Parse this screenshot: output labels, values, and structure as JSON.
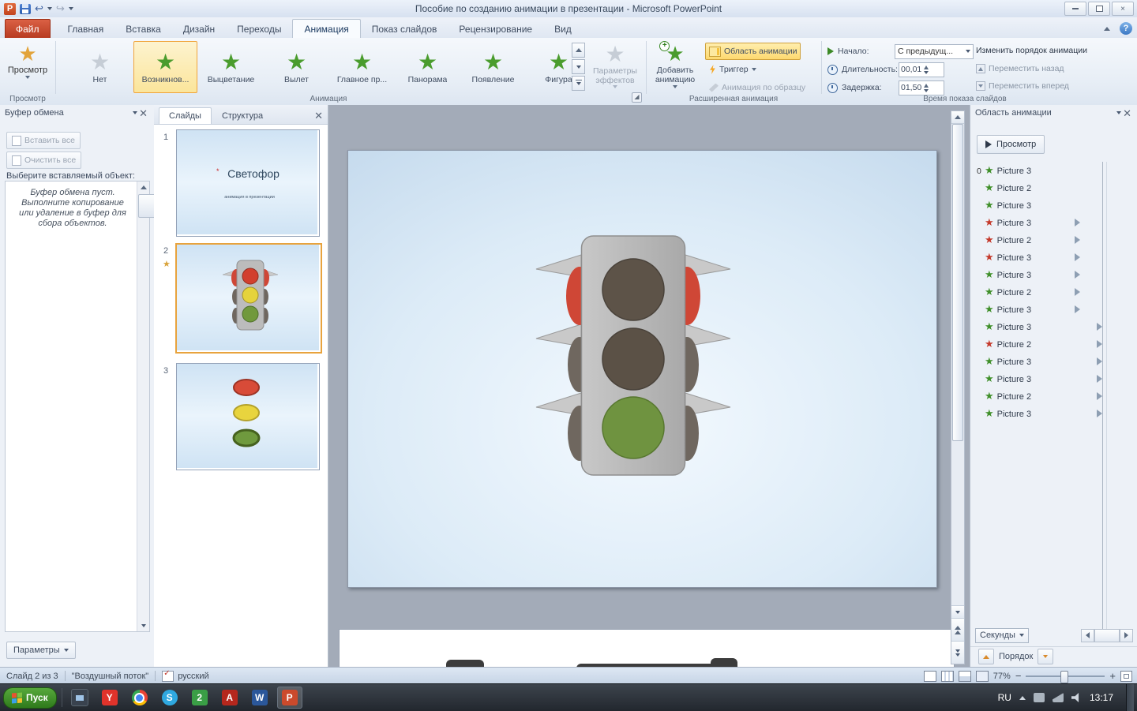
{
  "title_bar": {
    "title": "Пособие по созданию анимации в презентации  -  Microsoft PowerPoint"
  },
  "ribbon_tabs": [
    {
      "label": "Файл",
      "state": "file"
    },
    {
      "label": "Главная",
      "state": "normal"
    },
    {
      "label": "Вставка",
      "state": "normal"
    },
    {
      "label": "Дизайн",
      "state": "normal"
    },
    {
      "label": "Переходы",
      "state": "normal"
    },
    {
      "label": "Анимация",
      "state": "active"
    },
    {
      "label": "Показ слайдов",
      "state": "normal"
    },
    {
      "label": "Рецензирование",
      "state": "normal"
    },
    {
      "label": "Вид",
      "state": "normal"
    }
  ],
  "ribbon": {
    "preview_button": "Просмотр",
    "group_preview": "Просмотр",
    "gallery": [
      {
        "label": "Нет",
        "state": "none"
      },
      {
        "label": "Возникнов...",
        "state": "selected"
      },
      {
        "label": "Выцветание",
        "state": "normal"
      },
      {
        "label": "Вылет",
        "state": "normal"
      },
      {
        "label": "Главное пр...",
        "state": "normal"
      },
      {
        "label": "Панорама",
        "state": "normal"
      },
      {
        "label": "Появление",
        "state": "normal"
      },
      {
        "label": "Фигура",
        "state": "normal"
      }
    ],
    "group_animation": "Анимация",
    "effect_options": "Параметры эффектов",
    "add_animation": "Добавить анимацию",
    "animation_pane": "Область анимации",
    "trigger": "Триггер",
    "animation_painter": "Анимация по образцу",
    "group_advanced": "Расширенная анимация",
    "start_label": "Начало:",
    "start_value": "С предыдущ...",
    "duration_label": "Длительность:",
    "duration_value": "00,01",
    "delay_label": "Задержка:",
    "delay_value": "01,50",
    "reorder_title": "Изменить порядок анимации",
    "move_earlier": "Переместить назад",
    "move_later": "Переместить вперед",
    "group_timing": "Время показа слайдов"
  },
  "clipboard": {
    "title": "Буфер обмена",
    "paste_all": "Вставить все",
    "clear_all": "Очистить все",
    "choose_label": "Выберите вставляемый объект:",
    "empty_message": "Буфер обмена пуст. Выполните копирование или удаление в буфер для сбора объектов.",
    "options_button": "Параметры"
  },
  "slides_panel": {
    "tab_slides": "Слайды",
    "tab_outline": "Структура",
    "slides": [
      {
        "number": "1"
      },
      {
        "number": "2"
      },
      {
        "number": "3"
      }
    ],
    "slide1_title": "Светофор",
    "slide1_subtitle": "анимация  в  презентации"
  },
  "animation_pane": {
    "title": "Область анимации",
    "play_button": "Просмотр",
    "items": [
      {
        "prefix": "0",
        "label": "Picture 3",
        "star": "green",
        "marker": "none"
      },
      {
        "prefix": "",
        "label": "Picture 2",
        "star": "green",
        "marker": "none"
      },
      {
        "prefix": "",
        "label": "Picture 3",
        "star": "green",
        "marker": "none"
      },
      {
        "prefix": "",
        "label": "Picture 3",
        "star": "red",
        "marker": "near"
      },
      {
        "prefix": "",
        "label": "Picture 2",
        "star": "red",
        "marker": "near"
      },
      {
        "prefix": "",
        "label": "Picture 3",
        "star": "red",
        "marker": "near"
      },
      {
        "prefix": "",
        "label": "Picture 3",
        "star": "green",
        "marker": "near"
      },
      {
        "prefix": "",
        "label": "Picture 2",
        "star": "green",
        "marker": "near"
      },
      {
        "prefix": "",
        "label": "Picture 3",
        "star": "green",
        "marker": "near"
      },
      {
        "prefix": "",
        "label": "Picture 3",
        "star": "green",
        "marker": "far"
      },
      {
        "prefix": "",
        "label": "Picture 2",
        "star": "red",
        "marker": "far"
      },
      {
        "prefix": "",
        "label": "Picture 3",
        "star": "green",
        "marker": "far"
      },
      {
        "prefix": "",
        "label": "Picture 3",
        "star": "green",
        "marker": "far"
      },
      {
        "prefix": "",
        "label": "Picture 2",
        "star": "green",
        "marker": "far"
      },
      {
        "prefix": "",
        "label": "Picture 3",
        "star": "green",
        "marker": "far"
      }
    ],
    "seconds_label": "Секунды",
    "order_label": "Порядок"
  },
  "status_bar": {
    "slide_info": "Слайд 2 из 3",
    "theme_name": "\"Воздушный поток\"",
    "language": "русский",
    "zoom_value": "77%"
  },
  "taskbar": {
    "start_label": "Пуск",
    "apps": [
      {
        "name": "computer",
        "glyph": ""
      },
      {
        "name": "yandex",
        "glyph": "Y"
      },
      {
        "name": "chrome",
        "glyph": ""
      },
      {
        "name": "skype",
        "glyph": "S"
      },
      {
        "name": "maps",
        "glyph": "2"
      },
      {
        "name": "acrobat",
        "glyph": "A"
      },
      {
        "name": "word",
        "glyph": "W"
      },
      {
        "name": "powerpoint",
        "glyph": "P"
      }
    ],
    "language_indicator": "RU",
    "time": "13:17"
  }
}
